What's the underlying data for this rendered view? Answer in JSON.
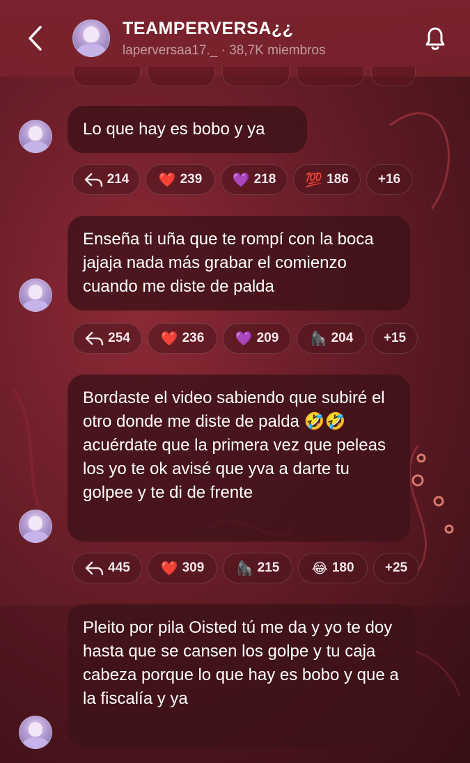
{
  "header": {
    "title": "TEAMPERVERSA¿¿",
    "username": "laperversaa17._",
    "members": "· 38,7K miembros"
  },
  "messages": [
    {
      "text": "Lo que hay es bobo y ya",
      "reactions": [
        {
          "icon": "reply-icon",
          "count": "214"
        },
        {
          "icon": "heart-icon",
          "emoji": "❤️",
          "count": "239"
        },
        {
          "icon": "purple-heart-icon",
          "emoji": "💜",
          "count": "218"
        },
        {
          "icon": "hundred-icon",
          "emoji": "💯",
          "count": "186"
        },
        {
          "icon": "more",
          "count": "+16"
        }
      ]
    },
    {
      "text": "Enseña ti uña que te rompí con la boca jajaja nada más grabar el comienzo cuando me diste de palda",
      "reactions": [
        {
          "icon": "reply-icon",
          "count": "254"
        },
        {
          "icon": "heart-icon",
          "emoji": "❤️",
          "count": "236"
        },
        {
          "icon": "purple-heart-icon",
          "emoji": "💜",
          "count": "209"
        },
        {
          "icon": "gorilla-icon",
          "emoji": "🦍",
          "count": "204"
        },
        {
          "icon": "more",
          "count": "+15"
        }
      ]
    },
    {
      "text": "Bordaste el video sabiendo que subiré el otro donde me diste de palda 🤣🤣 acuérdate que la primera vez que peleas los yo te ok avisé que yva a darte tu golpee y te di de frente",
      "reactions": [
        {
          "icon": "reply-icon",
          "count": "445"
        },
        {
          "icon": "heart-icon",
          "emoji": "❤️",
          "count": "309"
        },
        {
          "icon": "gorilla-icon",
          "emoji": "🦍",
          "count": "215"
        },
        {
          "icon": "laughing-icon",
          "emoji": "😂",
          "count": "180"
        },
        {
          "icon": "more",
          "count": "+25"
        }
      ]
    },
    {
      "text": "Pleito por pila Oisted tú me da y yo te doy hasta que se cansen los golpe y tu caja cabeza porque lo que hay es bobo y que a la fiscalía y ya",
      "reactions": []
    }
  ],
  "colors": {
    "background": "#6e1f2a",
    "bubble": "#3e1219",
    "accent_text": "#ffffff"
  }
}
